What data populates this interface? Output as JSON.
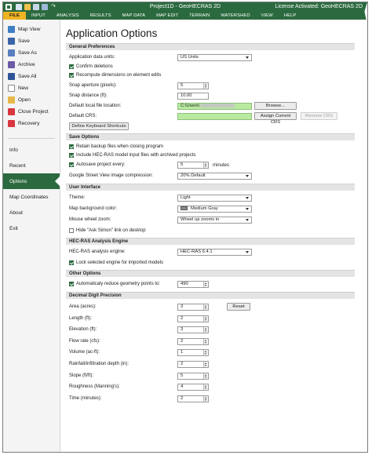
{
  "window": {
    "title": "Project1D - GeoHECRAS 2D",
    "license": "License Activated: GeoHECRAS 2D",
    "qat_redo": "↷"
  },
  "ribbon": {
    "tabs": [
      "FILE",
      "INPUT",
      "ANALYSIS",
      "RESULTS",
      "MAP DATA",
      "MAP EDIT",
      "TERRAIN",
      "WATERSHED",
      "VIEW",
      "HELP"
    ]
  },
  "sidebar": {
    "actions": [
      {
        "label": "Map View",
        "icon": "map-icon"
      },
      {
        "label": "Save",
        "icon": "save-icon"
      },
      {
        "label": "Save As",
        "icon": "save-as-icon"
      },
      {
        "label": "Archive",
        "icon": "archive-icon"
      },
      {
        "label": "Save All",
        "icon": "save-all-icon"
      },
      {
        "label": "New",
        "icon": "new-file-icon"
      },
      {
        "label": "Open",
        "icon": "folder-icon"
      },
      {
        "label": "Close Project",
        "icon": "close-icon"
      },
      {
        "label": "Recovery",
        "icon": "recovery-icon"
      }
    ],
    "sections": [
      "Info",
      "Recent",
      "Options",
      "Map Coordinates",
      "About",
      "Exit"
    ],
    "active_section": "Options"
  },
  "main": {
    "title": "Application Options",
    "general": {
      "header": "General Preferences",
      "units_label": "Application data units:",
      "units_value": "US Units",
      "confirm_deletions": "Confirm deletions",
      "recompute": "Recompute dimensions on element edits",
      "snap_aperture_label": "Snap aperture (pixels):",
      "snap_aperture_value": "5",
      "snap_distance_label": "Snap distance (ft):",
      "snap_distance_value": "10.00",
      "local_folder_label": "Default local file location:",
      "local_folder_value": "C:\\Users\\",
      "browse_label": "Browse...",
      "crs_label": "Default CRS:",
      "assign_crs_label": "Assign Current CRS",
      "remove_crs_label": "Remove CRS",
      "shortcuts_label": "Define Keyboard Shortcuts"
    },
    "save": {
      "header": "Save Options",
      "retain_backup": "Retain backup files when closing program",
      "include_hecras": "Include HEC-RAS model input files with archived projects",
      "autosave_label": "Autosave project every:",
      "autosave_value": "5",
      "autosave_unit": "minutes",
      "streetview_label": "Google Street View image compression:",
      "streetview_value": "20% Default"
    },
    "ui": {
      "header": "User Interface",
      "theme_label": "Theme:",
      "theme_value": "Light",
      "map_bg_label": "Map background color:",
      "map_bg_value": "Medium Gray",
      "wheel_label": "Mouse wheel zoom:",
      "wheel_value": "Wheel up zooms in",
      "hide_simon": "Hide \"Ask Simon\" link on desktop"
    },
    "engine": {
      "header": "HEC-RAS Analysis Engine",
      "engine_label": "HEC-RAS analysis engine:",
      "engine_value": "HEC-RAS 6.4.1",
      "lock_engine": "Lock selected engine for imported models"
    },
    "other": {
      "header": "Other Options",
      "auto_reduce_label": "Automaticaly reduce geometry points to:",
      "auto_reduce_value": "490"
    },
    "precision": {
      "header": "Decimal Digit Precision",
      "reset_label": "Reset",
      "rows": [
        {
          "label": "Area (acres):",
          "value": "3"
        },
        {
          "label": "Length (ft):",
          "value": "2"
        },
        {
          "label": "Elevation (ft):",
          "value": "3"
        },
        {
          "label": "Flow rate (cfs):",
          "value": "2"
        },
        {
          "label": "Volume (ac-ft):",
          "value": "1"
        },
        {
          "label": "Rainfall/infiltration depth (in):",
          "value": "2"
        },
        {
          "label": "Slope (ft/ft):",
          "value": "5"
        },
        {
          "label": "Roughness (Manning's):",
          "value": "4"
        },
        {
          "label": "Time (minutes):",
          "value": "2"
        }
      ]
    }
  },
  "colors": {
    "brand_green": "#2b6a3f",
    "file_tab": "#f0b323",
    "crs_field": "#b8eaa0"
  }
}
